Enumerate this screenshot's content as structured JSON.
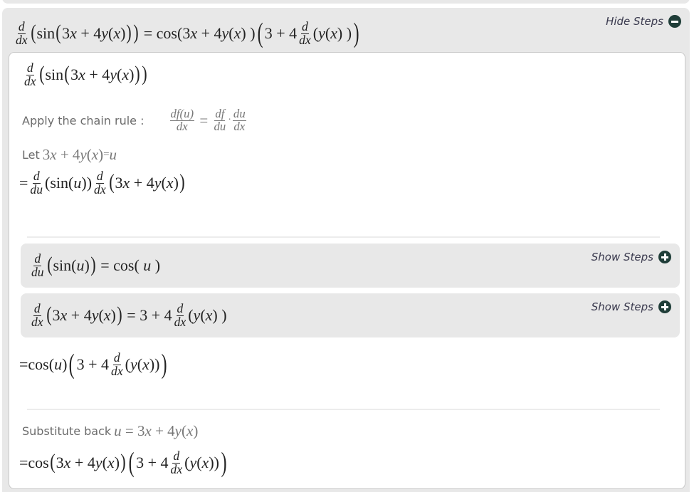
{
  "main_step": {
    "lhs_text": "d/dx(sin(3x + 4y(x)))",
    "rhs_text": "= cos(3x + 4y(x))(3 + 4 d/dx(y(x)))",
    "toggle_label": "Hide Steps",
    "toggle_icon": "minus-circle-icon"
  },
  "detail": {
    "start_expression": "d/dx(sin(3x + 4y(x)))",
    "chain_rule_label": "Apply the chain rule :",
    "chain_rule_formula": "df(u)/dx = df/du · du/dx",
    "let_label": "Let",
    "let_expression": "3x + 4y(x) = u",
    "chain_applied": "= d/du(sin(u)) d/dx(3x + 4y(x))",
    "substeps": [
      {
        "expression": "d/du(sin(u)) = cos(u)",
        "toggle_label": "Show Steps",
        "toggle_icon": "plus-circle-icon"
      },
      {
        "expression": "d/dx(3x + 4y(x)) = 3 + 4 d/dx(y(x))",
        "toggle_label": "Show Steps",
        "toggle_icon": "plus-circle-icon"
      }
    ],
    "combined": "= cos(u)(3 + 4 d/dx(y(x)))",
    "substitute_label": "Substitute back",
    "substitute_expression": "u = 3x + 4y(x)",
    "final": "= cos(3x + 4y(x))(3 + 4 d/dx(y(x)))"
  },
  "tokens": {
    "d": "d",
    "dx": "dx",
    "du": "du",
    "df": "df",
    "dfu": "df(u)",
    "sin": "sin",
    "cos": "cos",
    "eq": "=",
    "plus": "+",
    "dot": "·",
    "three": "3",
    "four": "4",
    "x": "x",
    "y": "y",
    "u": "u",
    "lp": "(",
    "rp": ")"
  },
  "colors": {
    "panel_bg": "#e8e8e8",
    "inner_bg": "#ffffff",
    "icon": "#1f3d38",
    "toggle_text": "#3a3a4e",
    "label_text": "#6b6b6b"
  }
}
